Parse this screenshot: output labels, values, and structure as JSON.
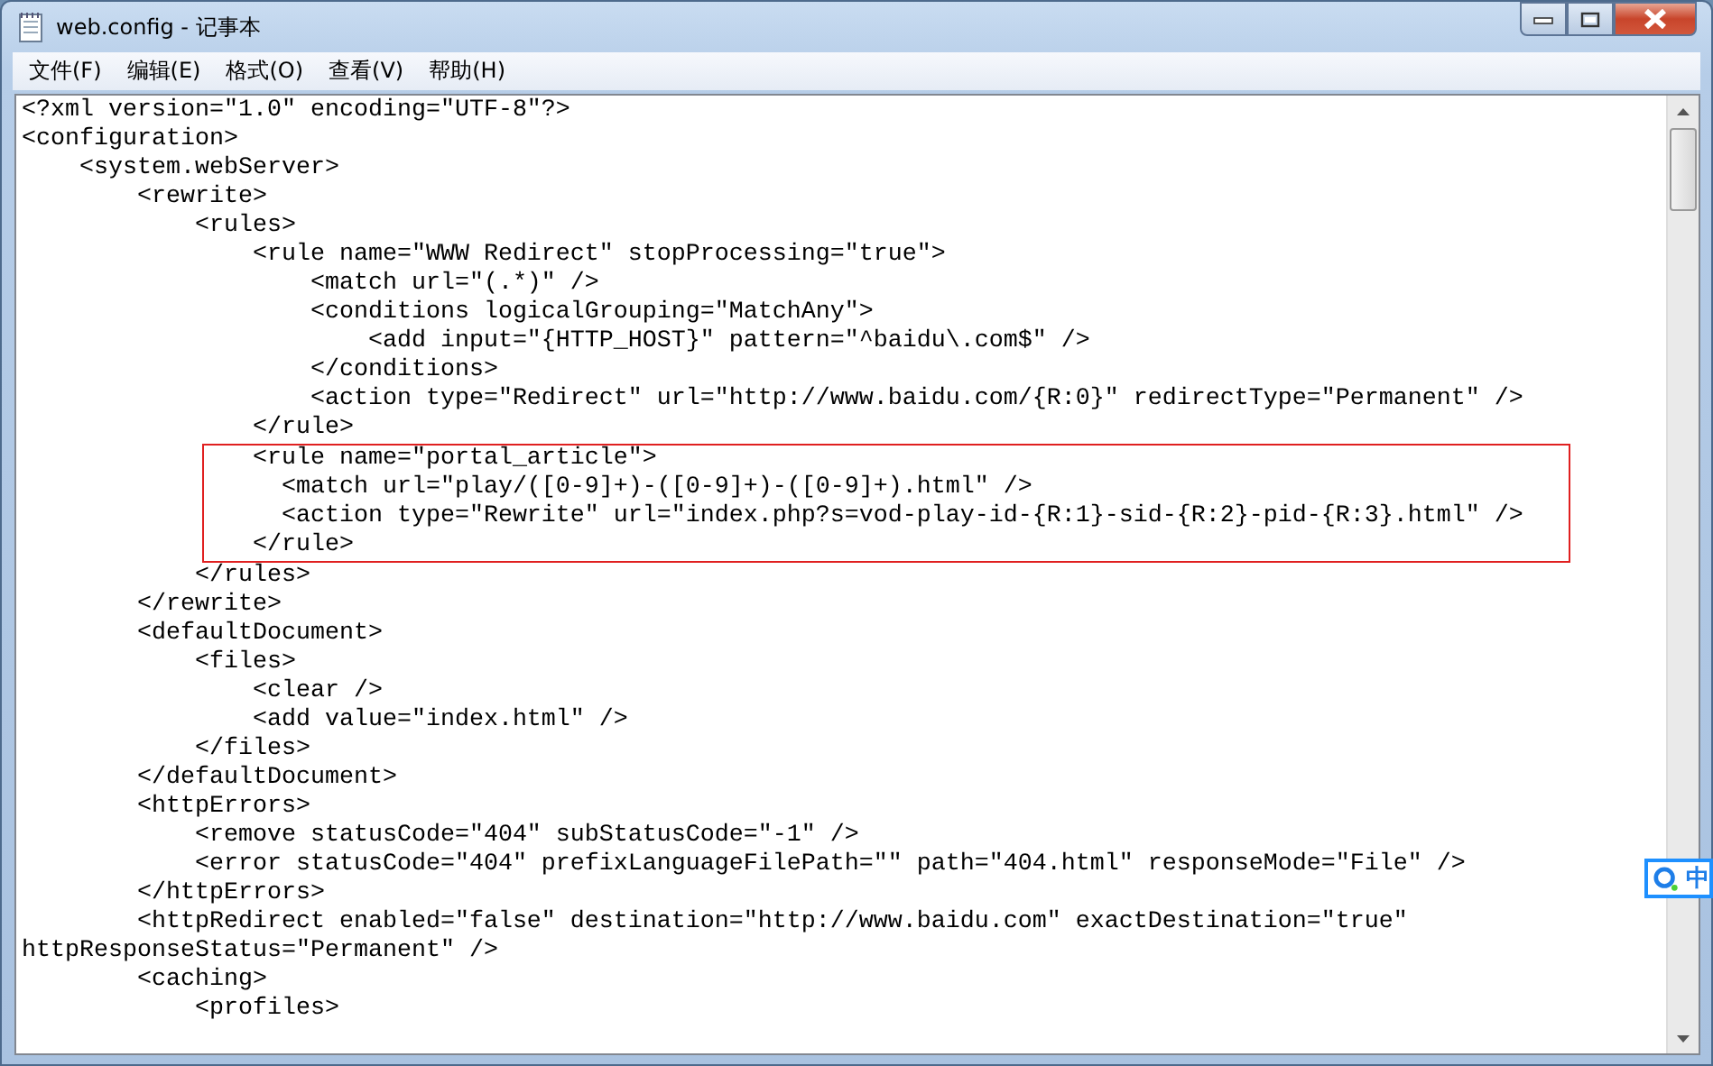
{
  "window": {
    "title": "web.config - 记事本"
  },
  "menu": [
    {
      "label": "文件(F)"
    },
    {
      "label": "编辑(E)"
    },
    {
      "label": "格式(O)"
    },
    {
      "label": "查看(V)"
    },
    {
      "label": "帮助(H)"
    }
  ],
  "editor": {
    "lines": [
      {
        "text": "<?xml version=\"1.0\" encoding=\"UTF-8\"?>",
        "highlighted": false
      },
      {
        "text": "<configuration>",
        "highlighted": false
      },
      {
        "text": "    <system.webServer>",
        "highlighted": false
      },
      {
        "text": "        <rewrite>",
        "highlighted": false
      },
      {
        "text": "            <rules>",
        "highlighted": false
      },
      {
        "text": "                <rule name=\"WWW Redirect\" stopProcessing=\"true\">",
        "highlighted": false
      },
      {
        "text": "                    <match url=\"(.*)\" />",
        "highlighted": false
      },
      {
        "text": "                    <conditions logicalGrouping=\"MatchAny\">",
        "highlighted": false
      },
      {
        "text": "                        <add input=\"{HTTP_HOST}\" pattern=\"^baidu\\.com$\" />",
        "highlighted": false
      },
      {
        "text": "                    </conditions>",
        "highlighted": false
      },
      {
        "text": "                    <action type=\"Redirect\" url=\"http://www.baidu.com/{R:0}\" redirectType=\"Permanent\" />",
        "highlighted": false
      },
      {
        "text": "                </rule>",
        "highlighted": false
      },
      {
        "text": "                <rule name=\"portal_article\">",
        "highlighted": true
      },
      {
        "text": "                  <match url=\"play/([0-9]+)-([0-9]+)-([0-9]+).html\" />",
        "highlighted": true
      },
      {
        "text": "                  <action type=\"Rewrite\" url=\"index.php?s=vod-play-id-{R:1}-sid-{R:2}-pid-{R:3}.html\" />",
        "highlighted": true
      },
      {
        "text": "                </rule>",
        "highlighted": true
      },
      {
        "text": "            </rules>",
        "highlighted": false
      },
      {
        "text": "        </rewrite>",
        "highlighted": false
      },
      {
        "text": "        <defaultDocument>",
        "highlighted": false
      },
      {
        "text": "            <files>",
        "highlighted": false
      },
      {
        "text": "                <clear />",
        "highlighted": false
      },
      {
        "text": "                <add value=\"index.html\" />",
        "highlighted": false
      },
      {
        "text": "            </files>",
        "highlighted": false
      },
      {
        "text": "        </defaultDocument>",
        "highlighted": false
      },
      {
        "text": "        <httpErrors>",
        "highlighted": false
      },
      {
        "text": "            <remove statusCode=\"404\" subStatusCode=\"-1\" />",
        "highlighted": false
      },
      {
        "text": "            <error statusCode=\"404\" prefixLanguageFilePath=\"\" path=\"404.html\" responseMode=\"File\" />",
        "highlighted": false
      },
      {
        "text": "        </httpErrors>",
        "highlighted": false
      },
      {
        "text": "        <httpRedirect enabled=\"false\" destination=\"http://www.baidu.com\" exactDestination=\"true\"",
        "highlighted": false
      },
      {
        "text": "httpResponseStatus=\"Permanent\" />",
        "highlighted": false
      },
      {
        "text": "        <caching>",
        "highlighted": false
      },
      {
        "text": "            <profiles>",
        "highlighted": false
      }
    ]
  },
  "ime": {
    "label": "中"
  }
}
